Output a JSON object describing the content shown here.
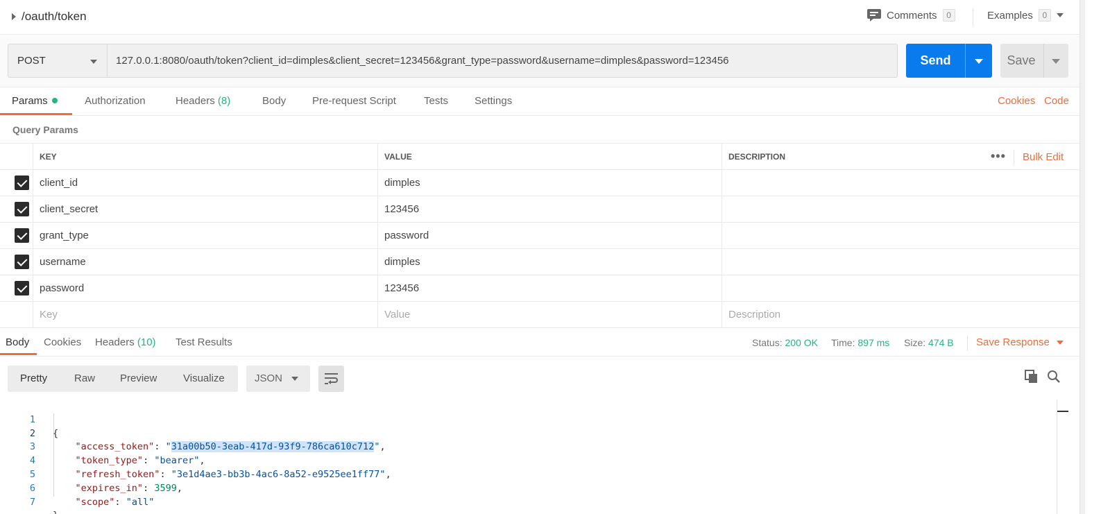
{
  "header": {
    "title": "/oauth/token",
    "comments_label": "Comments",
    "comments_count": "0",
    "examples_label": "Examples",
    "examples_count": "0"
  },
  "request": {
    "method": "POST",
    "url": "127.0.0.1:8080/oauth/token?client_id=dimples&client_secret=123456&grant_type=password&username=dimples&password=123456",
    "send_label": "Send",
    "save_label": "Save"
  },
  "request_tabs": {
    "params": "Params",
    "authorization": "Authorization",
    "headers": "Headers",
    "headers_count": "(8)",
    "body": "Body",
    "prerequest": "Pre-request Script",
    "tests": "Tests",
    "settings": "Settings",
    "cookies": "Cookies",
    "code": "Code"
  },
  "query_params": {
    "title": "Query Params",
    "columns": {
      "key": "KEY",
      "value": "VALUE",
      "description": "DESCRIPTION"
    },
    "more": "•••",
    "bulk_edit": "Bulk Edit",
    "rows": [
      {
        "key": "client_id",
        "value": "dimples",
        "description": "",
        "checked": true
      },
      {
        "key": "client_secret",
        "value": "123456",
        "description": "",
        "checked": true
      },
      {
        "key": "grant_type",
        "value": "password",
        "description": "",
        "checked": true
      },
      {
        "key": "username",
        "value": "dimples",
        "description": "",
        "checked": true
      },
      {
        "key": "password",
        "value": "123456",
        "description": "",
        "checked": true
      }
    ],
    "placeholder": {
      "key": "Key",
      "value": "Value",
      "description": "Description"
    }
  },
  "response_tabs": {
    "body": "Body",
    "cookies": "Cookies",
    "headers": "Headers",
    "headers_count": "(10)",
    "test_results": "Test Results"
  },
  "response_status": {
    "status_label": "Status:",
    "status_value": "200 OK",
    "time_label": "Time:",
    "time_value": "897 ms",
    "size_label": "Size:",
    "size_value": "474 B",
    "save_response": "Save Response"
  },
  "body_toolbar": {
    "views": [
      "Pretty",
      "Raw",
      "Preview",
      "Visualize"
    ],
    "selected_view": "Pretty",
    "format": "JSON"
  },
  "code": {
    "line_numbers": [
      "1",
      "2",
      "3",
      "4",
      "5",
      "6",
      "7"
    ],
    "open_brace": "{",
    "close_brace": "}",
    "access_token_key": "\"access_token\"",
    "access_token_value": "31a00b50-3eab-417d-93f9-786ca610c712",
    "token_type_key": "\"token_type\"",
    "token_type_value": "\"bearer\"",
    "refresh_token_key": "\"refresh_token\"",
    "refresh_token_value": "\"3e1d4ae3-bb3b-4ac6-8a52-e9525ee1ff77\"",
    "expires_in_key": "\"expires_in\"",
    "expires_in_value": "3599",
    "scope_key": "\"scope\"",
    "scope_value": "\"all\""
  },
  "colors": {
    "accent": "#f26b3a",
    "send_blue": "#097bed",
    "success_green": "#26b47f"
  }
}
